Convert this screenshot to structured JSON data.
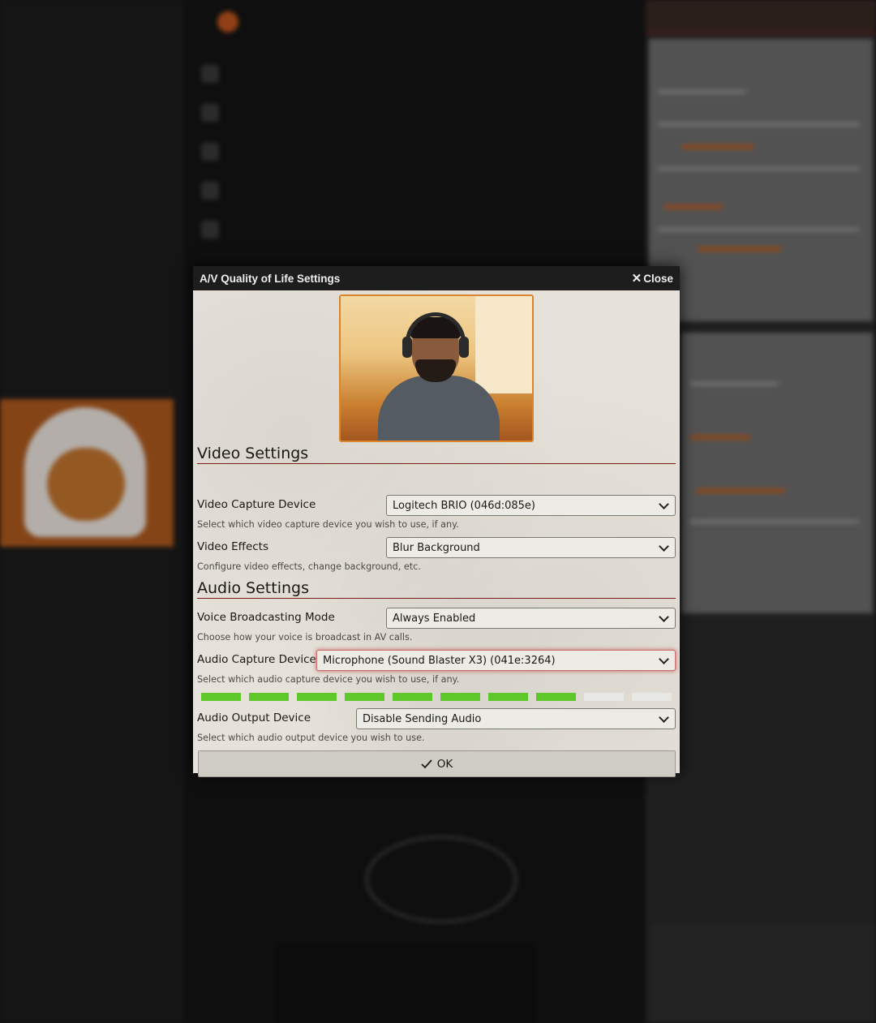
{
  "dialog": {
    "title": "A/V Quality of Life Settings",
    "close_label": "Close"
  },
  "video_settings": {
    "heading": "Video Settings",
    "capture_device_label": "Video Capture Device",
    "capture_device_value": "Logitech BRIO (046d:085e)",
    "capture_device_hint": "Select which video capture device you wish to use, if any.",
    "effects_label": "Video Effects",
    "effects_value": "Blur Background",
    "effects_hint": "Configure video effects, change background, etc."
  },
  "audio_settings": {
    "heading": "Audio Settings",
    "broadcast_mode_label": "Voice Broadcasting Mode",
    "broadcast_mode_value": "Always Enabled",
    "broadcast_mode_hint": "Choose how your voice is broadcast in AV calls.",
    "capture_device_label": "Audio Capture Device",
    "capture_device_value": "Microphone (Sound Blaster X3) (041e:3264)",
    "capture_device_hint": "Select which audio capture device you wish to use, if any.",
    "level_meter": {
      "segments": 10,
      "active": 8,
      "active_color": "#5ec82a",
      "inactive_color": "#e8e8e4"
    },
    "output_device_label": "Audio Output Device",
    "output_device_value": "Disable Sending Audio",
    "output_device_hint": "Select which audio output device you wish to use."
  },
  "ok_button": {
    "label": "OK",
    "icon": "check-icon"
  },
  "colors": {
    "accent": "#7a1f15",
    "video_border": "#d9852d",
    "focus_ring": "#c86d6d"
  }
}
